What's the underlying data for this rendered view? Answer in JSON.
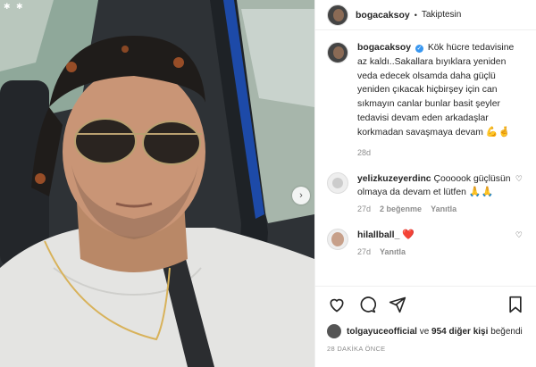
{
  "post": {
    "username": "bogacaksoy",
    "follow_label": "Takiptesin",
    "caption": "Kök hücre tedavisine az kaldı..Sakallara bıyıklara yeniden veda edecek olsamda daha güçlü yeniden çıkacak hiçbirşey için can sıkmayın canlar bunlar basit şeyler tedavisi devam eden arkadaşlar korkmadan savaşmaya devam",
    "caption_emoji": "💪🤞",
    "time": "28d"
  },
  "comments": [
    {
      "username": "yelizkuzeyerdinc",
      "text": "Çoooook güçlüsün olmaya da devam et lütfen",
      "emoji": "🙏🙏",
      "time": "27d",
      "likes": "2 beğenme",
      "reply": "Yanıtla"
    },
    {
      "username": "hilallball_",
      "text": "",
      "emoji": "❤️",
      "time": "27d",
      "likes": "",
      "reply": "Yanıtla"
    }
  ],
  "likes": {
    "liker": "tolgayuceofficial",
    "connector": "ve",
    "others": "954 diğer kişi",
    "suffix": "beğendi"
  },
  "time_ago": "28 DAKİKA ÖNCE",
  "icons": [
    "heart-icon",
    "comment-icon",
    "share-icon",
    "bookmark-icon",
    "chevron-right-icon",
    "verified-icon"
  ],
  "colors": {
    "verified": "#3897f0",
    "muted": "#8e8e8e",
    "text": "#262626"
  }
}
